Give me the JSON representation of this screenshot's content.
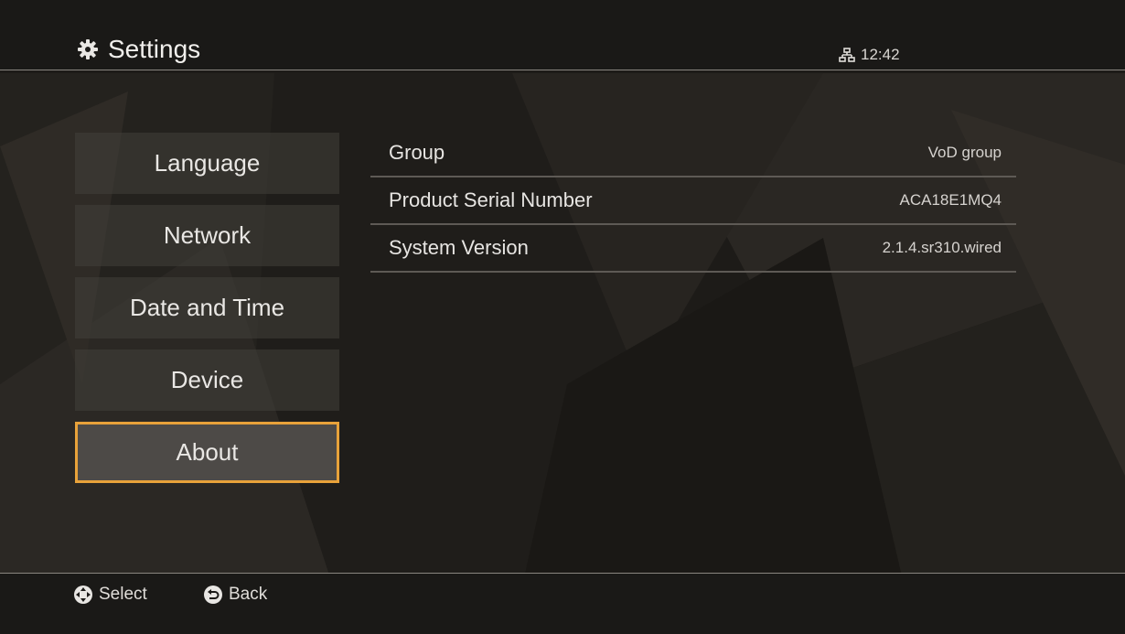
{
  "header": {
    "title": "Settings",
    "title_icon": "gear-icon",
    "status_icon": "network-icon",
    "time": "12:42"
  },
  "sidebar": {
    "items": [
      {
        "label": "Language",
        "active": false
      },
      {
        "label": "Network",
        "active": false
      },
      {
        "label": "Date and Time",
        "active": false
      },
      {
        "label": "Device",
        "active": false
      },
      {
        "label": "About",
        "active": true
      }
    ]
  },
  "about": {
    "rows": [
      {
        "label": "Group",
        "value": "VoD group"
      },
      {
        "label": "Product Serial Number",
        "value": "ACA18E1MQ4"
      },
      {
        "label": "System Version",
        "value": "2.1.4.sr310.wired"
      }
    ]
  },
  "footer": {
    "select_icon": "dpad-icon",
    "select_label": "Select",
    "back_icon": "back-arrow-icon",
    "back_label": "Back"
  },
  "colors": {
    "focus_border": "#e8a23a",
    "background": "#1d1b18"
  }
}
